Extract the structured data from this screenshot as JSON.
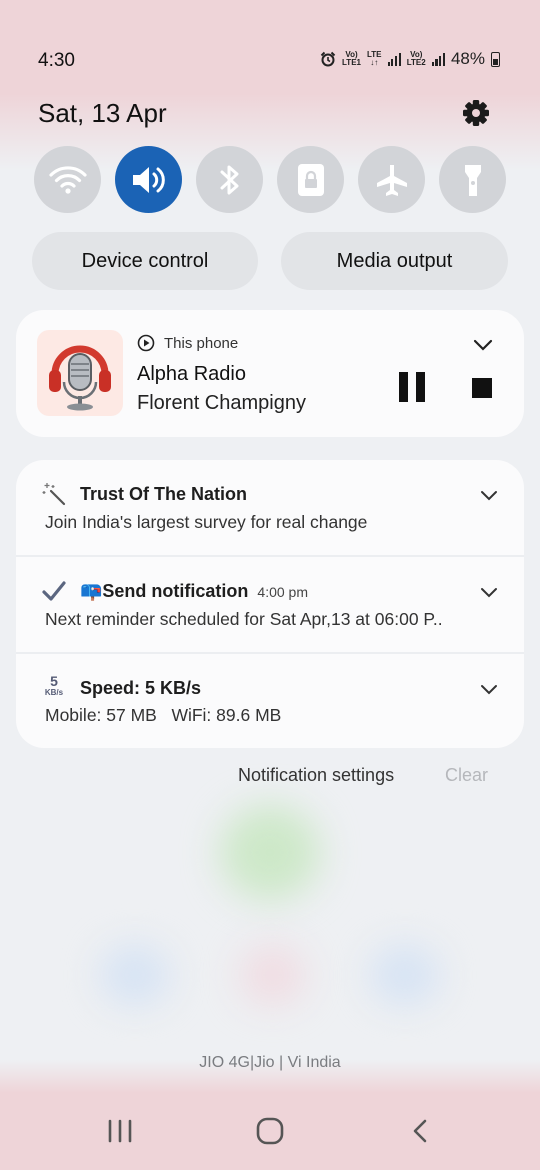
{
  "status_bar": {
    "time": "4:30",
    "sim1_volte": "Vo)",
    "sim1_lte": "LTE1",
    "data_type": "LTE",
    "sim2_volte": "Vo)",
    "sim2_lte": "LTE2",
    "battery": "48%",
    "icons": [
      "alarm-icon",
      "signal-sim1-icon",
      "signal-sim2-icon",
      "battery-icon"
    ]
  },
  "header": {
    "date": "Sat, 13 Apr",
    "settings_icon": "gear-icon"
  },
  "quick_settings": [
    {
      "icon": "wifi-icon",
      "active": false
    },
    {
      "icon": "sound-icon",
      "active": true
    },
    {
      "icon": "bluetooth-icon",
      "active": false
    },
    {
      "icon": "rotation-lock-icon",
      "active": false
    },
    {
      "icon": "airplane-icon",
      "active": false
    },
    {
      "icon": "flashlight-icon",
      "active": false
    }
  ],
  "pills": {
    "device_control": "Device control",
    "media_output": "Media output"
  },
  "media": {
    "source": "This phone",
    "title": "Alpha Radio",
    "artist": "Florent Champigny"
  },
  "notifications": [
    {
      "icon": "magic-wand-icon",
      "title": "Trust Of The Nation",
      "time": "",
      "body": "Join India's largest survey for real change"
    },
    {
      "icon": "check-icon",
      "title": "📪Send notification",
      "time": "4:00 pm",
      "body": "Next reminder scheduled for Sat Apr,13 at 06:00 P.."
    },
    {
      "icon": "speed-icon",
      "title": "Speed: 5 KB/s",
      "time": "",
      "body": "Mobile: 57 MB   WiFi: 89.6 MB",
      "icon_value": "5",
      "icon_unit": "KB/s"
    }
  ],
  "footer": {
    "notification_settings": "Notification settings",
    "clear": "Clear",
    "carrier": "JIO 4G|Jio | Vi India"
  },
  "colors": {
    "accent": "#1b63b5",
    "tint": "#eed4d8",
    "tile_inactive": "#d2d4d8"
  }
}
